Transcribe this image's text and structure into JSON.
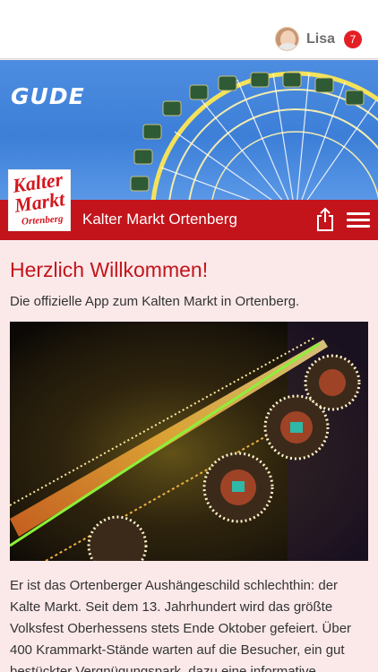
{
  "user": {
    "name": "Lisa",
    "notification_count": "7"
  },
  "hero": {
    "brand_text": "GUDE"
  },
  "logo": {
    "line1": "Kalter",
    "line2": "Markt",
    "line3": "Ortenberg"
  },
  "titlebar": {
    "title": "Kalter Markt Ortenberg",
    "share_icon": "share-icon",
    "menu_icon": "hamburger-menu-icon"
  },
  "content": {
    "heading": "Herzlich Willkommen!",
    "intro": "Die offizielle App zum Kalten Markt in Ortenberg.",
    "body": "Er ist das Ortenberger Aushängeschild schlechthin: der Kalte Markt. Seit dem 13. Jahrhundert wird das größte Volksfest Oberhessens stets Ende Oktober gefeiert. Über 400 Krammarkt-Stände warten auf die Besucher, ein gut bestückter Vergnügungspark, dazu eine informative Leistungsschau im"
  },
  "colors": {
    "brand_red": "#c3141b",
    "background": "#fbe9ea",
    "badge_red": "#e31f25"
  }
}
